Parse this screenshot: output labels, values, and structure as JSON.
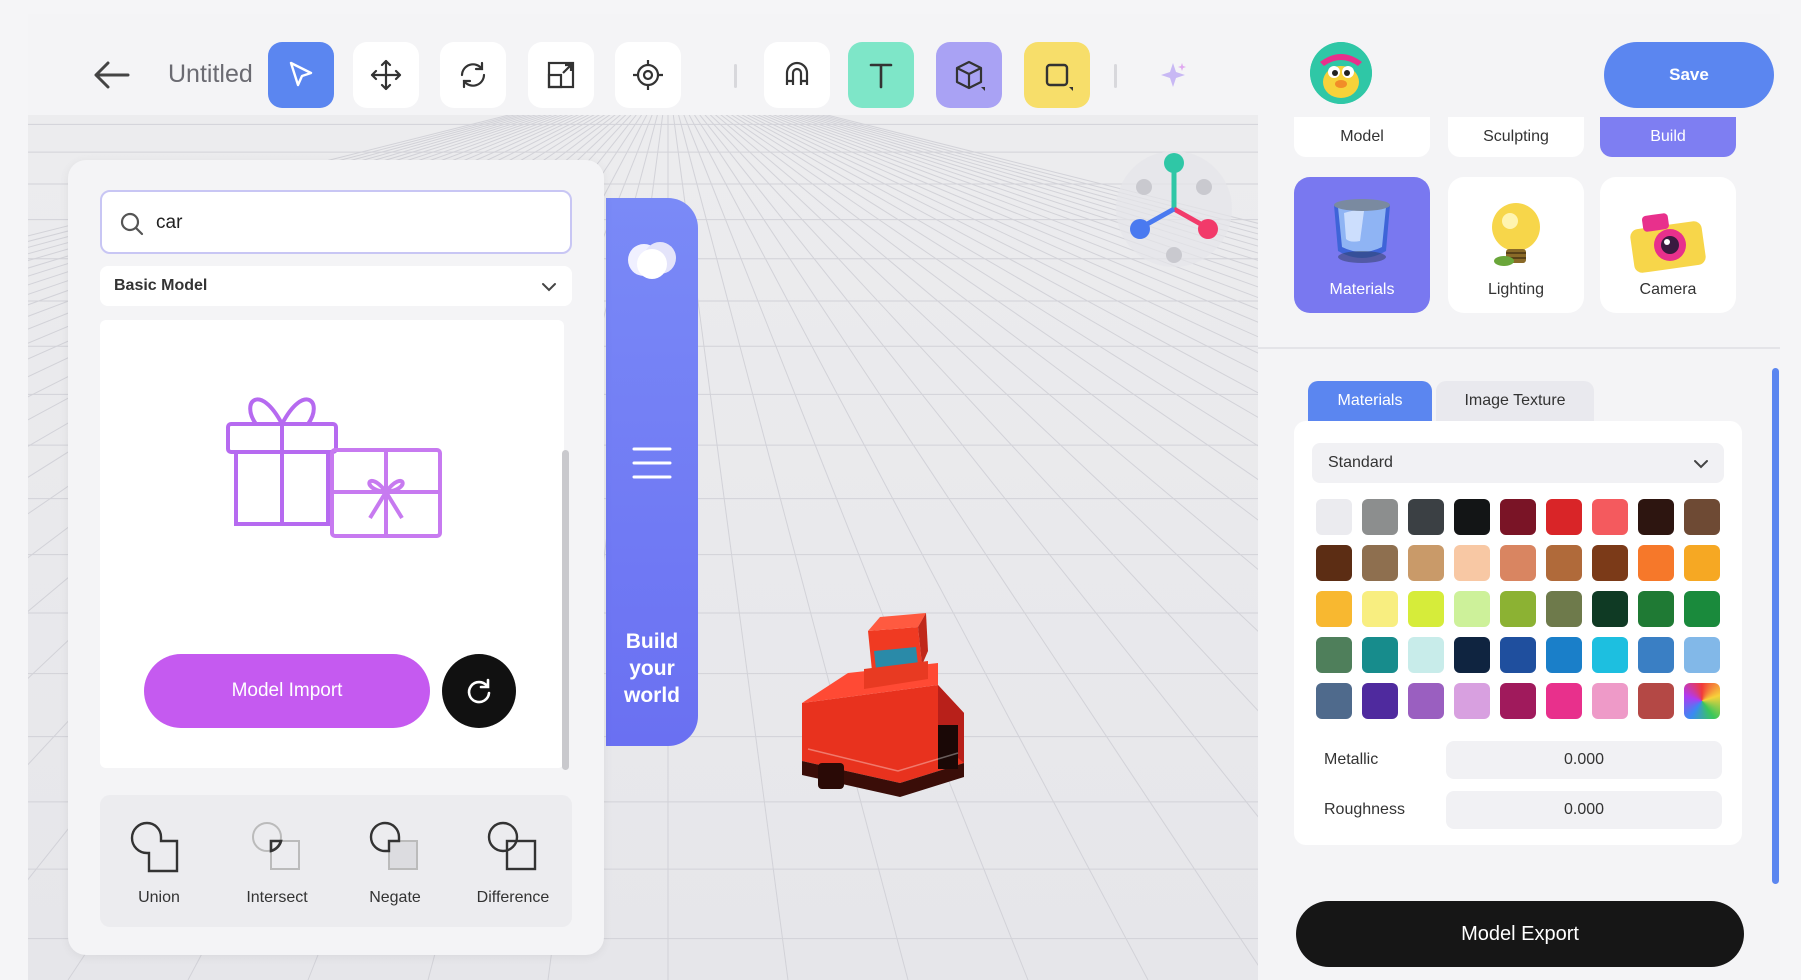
{
  "header": {
    "doc_title": "Untitled",
    "save_label": "Save",
    "tools": [
      {
        "name": "select-tool",
        "icon": "cursor-icon",
        "active": true
      },
      {
        "name": "move-tool",
        "icon": "move-arrows-icon"
      },
      {
        "name": "rotate-tool",
        "icon": "rotate-icon"
      },
      {
        "name": "scale-tool",
        "icon": "scale-icon"
      },
      {
        "name": "focus-tool",
        "icon": "target-icon"
      },
      {
        "name": "magnet-tool",
        "icon": "magnet-icon"
      },
      {
        "name": "text-tool",
        "icon": "text-icon"
      },
      {
        "name": "shape-3d-tool",
        "icon": "cube-icon"
      },
      {
        "name": "shape-2d-tool",
        "icon": "square-icon"
      },
      {
        "name": "ai-tool",
        "icon": "sparkle-icon"
      }
    ]
  },
  "library": {
    "search_value": "car",
    "category": "Basic Model",
    "import_label": "Model Import",
    "boolean_ops": [
      {
        "label": "Union",
        "icon": "union-icon"
      },
      {
        "label": "Intersect",
        "icon": "intersect-icon"
      },
      {
        "label": "Negate",
        "icon": "negate-icon"
      },
      {
        "label": "Difference",
        "icon": "difference-icon"
      }
    ]
  },
  "build_tab": {
    "line1": "Build",
    "line2": "your",
    "line3": "world"
  },
  "right_panel": {
    "mode_tabs": [
      "Model",
      "Sculpting",
      "Build"
    ],
    "active_mode": "Build",
    "categories": [
      "Materials",
      "Lighting",
      "Camera"
    ],
    "active_category": "Materials",
    "sub_tabs": [
      "Materials",
      "Image Texture"
    ],
    "active_sub_tab": "Materials",
    "material_type": "Standard",
    "palette": [
      "#ebebef",
      "#8c8e8e",
      "#3b4044",
      "#131516",
      "#7a1426",
      "#d92528",
      "#f45a5e",
      "#2d1510",
      "#6e4a34",
      "#5c2d14",
      "#8e6f4f",
      "#c99a69",
      "#f8c8a4",
      "#d98561",
      "#b06a3a",
      "#7b3a18",
      "#f6782a",
      "#f6a823",
      "#f8b830",
      "#f8ee80",
      "#d6ec3a",
      "#cdf19a",
      "#8cb233",
      "#6e7a4b",
      "#0f3a24",
      "#1f7a34",
      "#1a8a3c",
      "#4f7f5b",
      "#178c8c",
      "#c8ecea",
      "#0f2440",
      "#1f4f9e",
      "#1a7fc9",
      "#1dbfe0",
      "#3a7fc4",
      "#82b8e8",
      "#4f6a8c",
      "#4f2a9e",
      "#9a5fc0",
      "#d8a0e0",
      "#a01a5c",
      "#e8308c",
      "#ee9ac8",
      "#b44845",
      "rainbow"
    ],
    "metallic_label": "Metallic",
    "metallic_value": "0.000",
    "roughness_label": "Roughness",
    "roughness_value": "0.000",
    "export_label": "Model Export"
  },
  "colors": {
    "accent_blue": "#5b86f0",
    "accent_purple": "#7978f0",
    "import_purple": "#c55af0",
    "car_red": "#e8321e"
  }
}
